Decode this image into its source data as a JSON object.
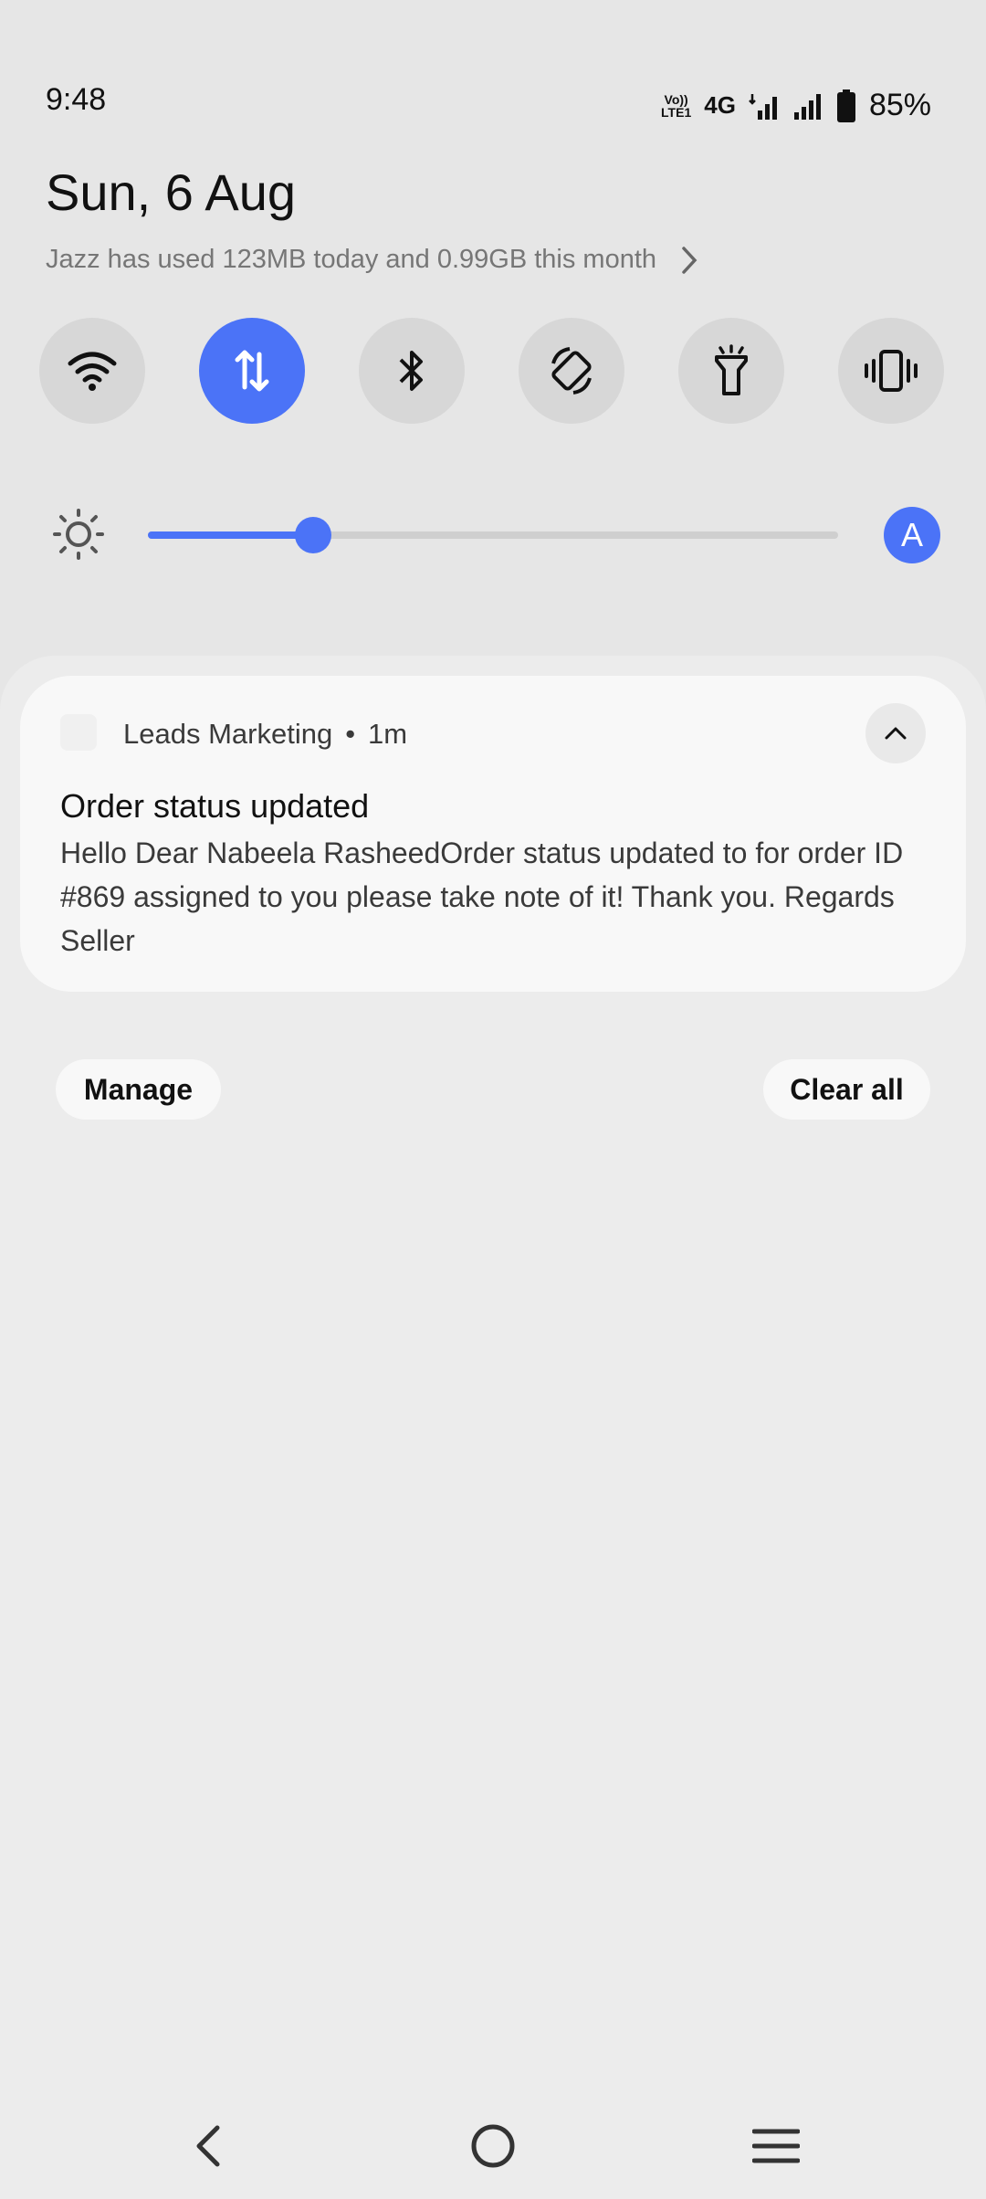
{
  "status_bar": {
    "time": "9:48",
    "volte_label_top": "Vo))",
    "volte_label_bottom": "LTE1",
    "network": "4G",
    "battery": "85%"
  },
  "header": {
    "date": "Sun, 6 Aug",
    "data_usage": "Jazz has used 123MB today and 0.99GB this month"
  },
  "quick_toggles": [
    {
      "name": "wifi-icon",
      "active": false
    },
    {
      "name": "mobile-data-icon",
      "active": true
    },
    {
      "name": "bluetooth-icon",
      "active": false
    },
    {
      "name": "auto-rotate-icon",
      "active": false
    },
    {
      "name": "flashlight-icon",
      "active": false
    },
    {
      "name": "vibrate-icon",
      "active": false
    }
  ],
  "brightness": {
    "level": 0.24,
    "auto_label": "A"
  },
  "notification": {
    "app_name": "Leads Marketing",
    "separator": "•",
    "time": "1m",
    "title": "Order status updated",
    "body": "Hello Dear Nabeela RasheedOrder status updated to for order ID #869 assigned to you please take note of it! Thank you. Regards Seller"
  },
  "actions": {
    "manage_label": "Manage",
    "clear_all_label": "Clear all"
  },
  "colors": {
    "accent": "#4b73f7",
    "background": "#e6e6e6",
    "card": "#f8f8f8"
  }
}
